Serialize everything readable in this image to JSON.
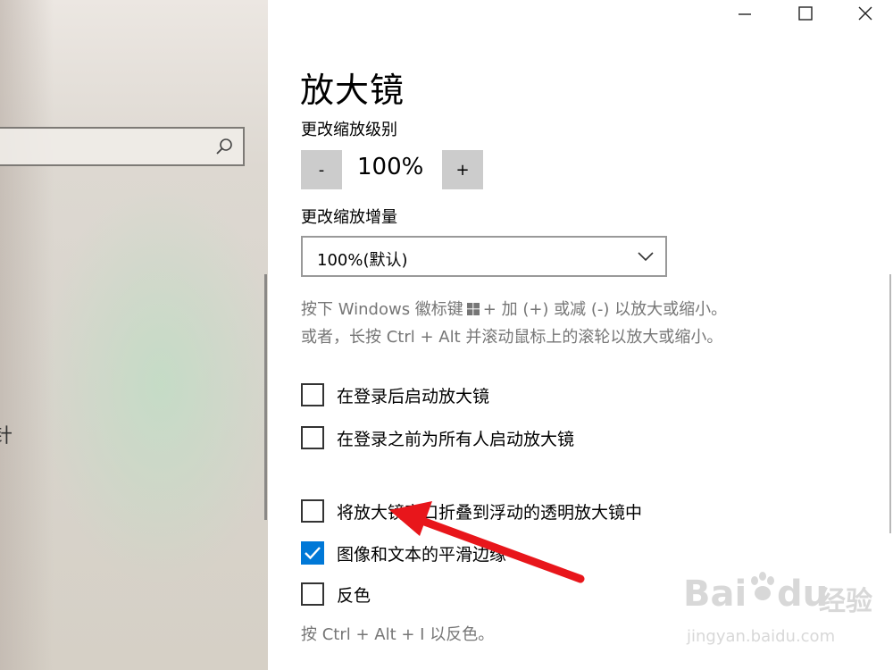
{
  "left": {
    "search_placeholder": "",
    "partial_glyph": "针"
  },
  "window": {
    "minimize_icon": "minimize-icon",
    "maximize_icon": "maximize-icon",
    "close_icon": "close-icon"
  },
  "page": {
    "title": "放大镜",
    "zoom_level_label": "更改缩放级别",
    "zoom_minus": "-",
    "zoom_value": "100%",
    "zoom_plus": "+",
    "zoom_increment_label": "更改缩放增量",
    "zoom_increment_value": "100%(默认)",
    "help_line1_a": "按下 Windows 徽标键",
    "help_line1_b": "+ 加 (+) 或减 (-) 以放大或缩小。",
    "help_line2": "或者，长按 Ctrl + Alt 并滚动鼠标上的滚轮以放大或缩小。",
    "invert_help": "按 Ctrl + Alt + I 以反色。"
  },
  "checkboxes": [
    {
      "label": "在登录后启动放大镜",
      "checked": false
    },
    {
      "label": "在登录之前为所有人启动放大镜",
      "checked": false
    },
    {
      "label": "将放大镜窗口折叠到浮动的透明放大镜中",
      "checked": false
    },
    {
      "label": "图像和文本的平滑边缘",
      "checked": true
    },
    {
      "label": "反色",
      "checked": false
    }
  ],
  "watermark": {
    "brand": "Bai",
    "brand_b": "du",
    "brand_cn": "经验",
    "url": "jingyan.baidu.com"
  },
  "colors": {
    "accent": "#0078d7",
    "annotation_arrow": "#e8161b"
  }
}
